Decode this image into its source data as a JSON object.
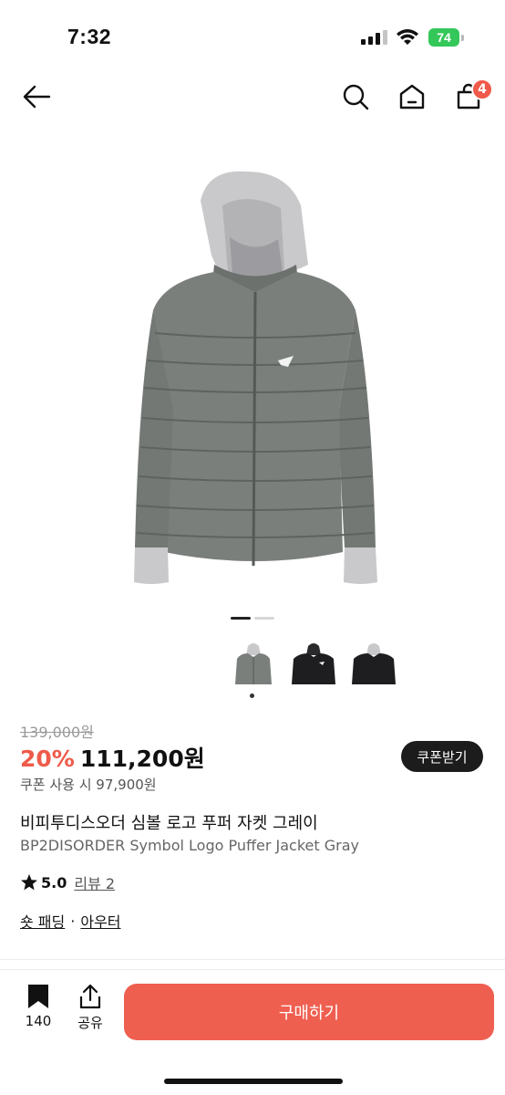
{
  "status_bar": {
    "time": "7:32",
    "battery": "74"
  },
  "nav": {
    "cart_count": "4"
  },
  "product": {
    "original_price": "139,000원",
    "discount": "20%",
    "sale_price": "111,200원",
    "coupon_button": "쿠폰받기",
    "coupon_price": "쿠폰 사용 시 97,900원",
    "title_ko": "비피투디스오더 심볼 로고 푸퍼 자켓 그레이",
    "title_en": "BP2DISORDER Symbol Logo Puffer Jacket Gray",
    "rating": "5.0",
    "review_link": "리뷰 2",
    "category_1": "숏 패딩",
    "category_sep": "·",
    "category_2": "아우터"
  },
  "bottom_bar": {
    "bookmark_count": "140",
    "share_label": "공유",
    "buy_button": "구매하기"
  },
  "colors": {
    "accent": "#ef5a4a",
    "buy_button": "#ef5f50",
    "jacket_gray": "#7b7f7c",
    "hood_light": "#c9c9cb",
    "jacket_black": "#1e1e20"
  },
  "icons": [
    "back-arrow-icon",
    "search-icon",
    "home-icon",
    "cart-icon",
    "star-icon",
    "bookmark-icon",
    "share-icon"
  ]
}
